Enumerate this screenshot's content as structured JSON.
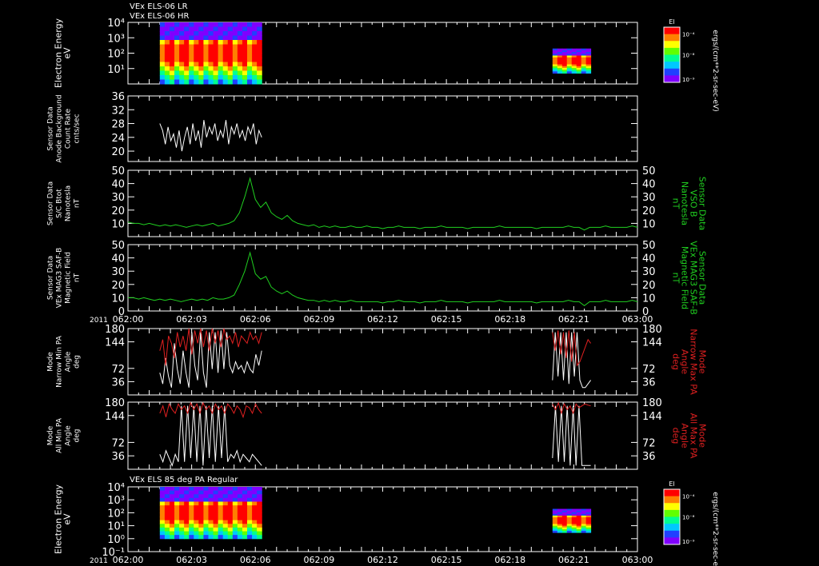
{
  "header": {
    "line1": "VEx ELS-06 LR",
    "line2": "VEx ELS-06 HR",
    "panel7_title": "VEx ELS 85 deg PA Regular"
  },
  "colorbar": {
    "title": "El",
    "ticks": [
      "10⁻⁴",
      "10⁻⁸",
      "10⁻⁹"
    ],
    "units": "ergs/(cm**2-sr-sec-eV)",
    "colors": [
      "#8000ff",
      "#2040ff",
      "#00c8ff",
      "#00ff90",
      "#60ff00",
      "#ffff00",
      "#ff8000",
      "#ff0000"
    ]
  },
  "time_axis": {
    "year": "2011",
    "labels": [
      "062:00",
      "062:03",
      "062:06",
      "062:09",
      "062:12",
      "062:15",
      "062:18",
      "062:21",
      "063:00"
    ]
  },
  "colors": {
    "white": "#ffffff",
    "green": "#20d020",
    "red": "#e02020",
    "frame": "#ffffff"
  },
  "chart_data": [
    {
      "type": "heatmap",
      "ylabel": [
        "Electron Energy",
        "eV"
      ],
      "ylog": true,
      "yticks": [
        "10⁴",
        "10³",
        "10²",
        "10¹"
      ],
      "ylim": [
        1,
        10000
      ],
      "blocks": [
        {
          "t_start": 1.5,
          "t_end": 6.3,
          "e_min": 1,
          "e_max": 10000
        },
        {
          "t_start": 20.0,
          "t_end": 21.8,
          "e_min": 5,
          "e_max": 200
        }
      ]
    },
    {
      "type": "line",
      "ylabel": [
        "Sensor Data",
        "Anode Background",
        "Count Rate",
        "cnts/sec"
      ],
      "yticks": [
        "36",
        "32",
        "28",
        "24",
        "20"
      ],
      "ylim": [
        17,
        36
      ],
      "series": [
        {
          "color": "white",
          "t_start": 1.5,
          "t_end": 6.3,
          "values": [
            28,
            26,
            22,
            27,
            23,
            25,
            21,
            26,
            20,
            24,
            27,
            22,
            28,
            23,
            26,
            21,
            29,
            24,
            27,
            25,
            28,
            23,
            26,
            24,
            29,
            22,
            27,
            25,
            28,
            24,
            26,
            23,
            27,
            25,
            28,
            22,
            26,
            24
          ]
        }
      ]
    },
    {
      "type": "line",
      "ylabel": [
        "Sensor Data",
        "S/C Btot",
        "Nanotesla",
        "nT"
      ],
      "ylabel_right": [
        "Sensor Data",
        "VSO B",
        "Nanotesla",
        "nT"
      ],
      "yticks": [
        "50",
        "40",
        "30",
        "20",
        "10"
      ],
      "ylim": [
        0,
        50
      ],
      "series": [
        {
          "color": "green",
          "t_start": 0,
          "t_end": 24,
          "values": [
            11,
            10,
            10,
            9,
            10,
            9,
            8,
            9,
            8,
            9,
            8,
            7,
            8,
            9,
            8,
            9,
            10,
            8,
            9,
            10,
            12,
            18,
            30,
            44,
            28,
            22,
            26,
            18,
            15,
            13,
            16,
            12,
            10,
            9,
            8,
            9,
            7,
            8,
            7,
            8,
            7,
            7,
            8,
            7,
            7,
            8,
            7,
            7,
            6,
            7,
            7,
            8,
            7,
            7,
            7,
            6,
            7,
            7,
            7,
            8,
            7,
            7,
            7,
            7,
            6,
            7,
            7,
            7,
            7,
            7,
            8,
            7,
            7,
            7,
            7,
            7,
            7,
            6,
            7,
            7,
            7,
            7,
            7,
            8,
            7,
            7,
            5,
            7,
            7,
            7,
            8,
            7,
            7,
            7,
            7,
            8,
            7
          ]
        }
      ]
    },
    {
      "type": "line",
      "ylabel": [
        "Sensor Data",
        "VEx MAG3 SAF-B",
        "Magnetic Field",
        "nT"
      ],
      "ylabel_right": [
        "Sensor Data",
        "VEx MAG3 SAF-B",
        "Magnetic Field",
        "nT"
      ],
      "yticks": [
        "50",
        "40",
        "30",
        "20",
        "10",
        "0"
      ],
      "ylim": [
        0,
        50
      ],
      "series": [
        {
          "color": "green",
          "t_start": 0,
          "t_end": 24,
          "values": [
            10,
            10,
            9,
            10,
            9,
            8,
            9,
            8,
            9,
            8,
            7,
            8,
            9,
            8,
            9,
            8,
            10,
            9,
            9,
            10,
            12,
            20,
            30,
            44,
            28,
            24,
            26,
            18,
            15,
            13,
            15,
            12,
            10,
            9,
            8,
            8,
            7,
            8,
            7,
            8,
            7,
            7,
            8,
            7,
            7,
            7,
            7,
            7,
            6,
            7,
            7,
            8,
            7,
            7,
            7,
            6,
            7,
            7,
            7,
            8,
            7,
            7,
            7,
            7,
            6,
            7,
            7,
            7,
            7,
            7,
            8,
            7,
            7,
            7,
            7,
            7,
            7,
            6,
            7,
            7,
            7,
            7,
            7,
            8,
            7,
            7,
            4,
            7,
            7,
            7,
            8,
            7,
            7,
            7,
            7,
            8,
            7
          ]
        }
      ]
    },
    {
      "type": "line",
      "ylabel": [
        "Mode",
        "Narrow Min PA",
        "Angle",
        "deg"
      ],
      "ylabel_right": [
        "Mode",
        "Narrow Max PA",
        "Angle",
        "deg"
      ],
      "yticks": [
        "180",
        "144",
        "108",
        "72",
        "36"
      ],
      "ylim": [
        0,
        180
      ],
      "series": [
        {
          "color": "white",
          "t_start": 1.5,
          "t_end": 6.3,
          "values": [
            60,
            30,
            100,
            50,
            20,
            140,
            70,
            30,
            120,
            60,
            20,
            170,
            80,
            40,
            170,
            60,
            20,
            170,
            70,
            170,
            60,
            175,
            70,
            170,
            80,
            60,
            90,
            70,
            80,
            60,
            90,
            70,
            60,
            110,
            80,
            120
          ]
        },
        {
          "color": "red",
          "t_start": 1.5,
          "t_end": 6.3,
          "values": [
            120,
            150,
            80,
            160,
            140,
            100,
            170,
            130,
            160,
            120,
            180,
            110,
            175,
            140,
            180,
            130,
            175,
            120,
            180,
            140,
            175,
            130,
            180,
            150,
            160,
            140,
            170,
            130,
            160,
            150,
            140,
            170,
            150,
            160,
            140,
            170
          ]
        },
        {
          "color": "white",
          "t_start": 20.0,
          "t_end": 21.8,
          "values": [
            40,
            170,
            50,
            170,
            40,
            170,
            30,
            170,
            50,
            170,
            40,
            20,
            20,
            30,
            40
          ]
        },
        {
          "color": "red",
          "t_start": 20.0,
          "t_end": 21.8,
          "values": [
            170,
            120,
            175,
            110,
            170,
            100,
            175,
            90,
            170,
            80,
            90,
            110,
            130,
            150,
            140
          ]
        }
      ]
    },
    {
      "type": "line",
      "ylabel": [
        "Mode",
        "All Min PA",
        "Angle",
        "deg"
      ],
      "ylabel_right": [
        "Mode",
        "All Max PA",
        "Angle",
        "deg"
      ],
      "yticks": [
        "180",
        "144",
        "108",
        "72",
        "36"
      ],
      "ylim": [
        0,
        180
      ],
      "series": [
        {
          "color": "white",
          "t_start": 1.5,
          "t_end": 6.3,
          "values": [
            40,
            20,
            50,
            30,
            10,
            40,
            20,
            170,
            20,
            170,
            30,
            170,
            20,
            170,
            10,
            170,
            30,
            170,
            20,
            170,
            30,
            170,
            20,
            40,
            30,
            50,
            20,
            40,
            30,
            20,
            40,
            30,
            20,
            10
          ]
        },
        {
          "color": "red",
          "t_start": 1.5,
          "t_end": 6.3,
          "values": [
            150,
            170,
            140,
            175,
            160,
            150,
            175,
            160,
            170,
            150,
            178,
            160,
            175,
            150,
            178,
            160,
            170,
            150,
            175,
            160,
            170,
            150,
            175,
            165,
            150,
            170,
            160,
            140,
            170,
            165,
            150,
            175,
            160,
            150
          ]
        },
        {
          "color": "white",
          "t_start": 20.0,
          "t_end": 21.8,
          "values": [
            30,
            170,
            20,
            170,
            20,
            170,
            10,
            170,
            10,
            170,
            10,
            10,
            10,
            10
          ]
        },
        {
          "color": "red",
          "t_start": 20.0,
          "t_end": 21.8,
          "values": [
            175,
            160,
            178,
            150,
            175,
            160,
            170,
            150,
            175,
            165,
            170,
            175,
            172,
            170
          ]
        }
      ]
    },
    {
      "type": "heatmap",
      "ylabel": [
        "Electron Energy",
        "eV"
      ],
      "ylog": true,
      "yticks": [
        "10⁴",
        "10³",
        "10²",
        "10¹",
        "10⁰",
        "10⁻¹"
      ],
      "ylim": [
        0.1,
        10000
      ],
      "blocks": [
        {
          "t_start": 1.5,
          "t_end": 6.3,
          "e_min": 1,
          "e_max": 10000
        },
        {
          "t_start": 20.0,
          "t_end": 21.8,
          "e_min": 3,
          "e_max": 200
        }
      ]
    }
  ]
}
